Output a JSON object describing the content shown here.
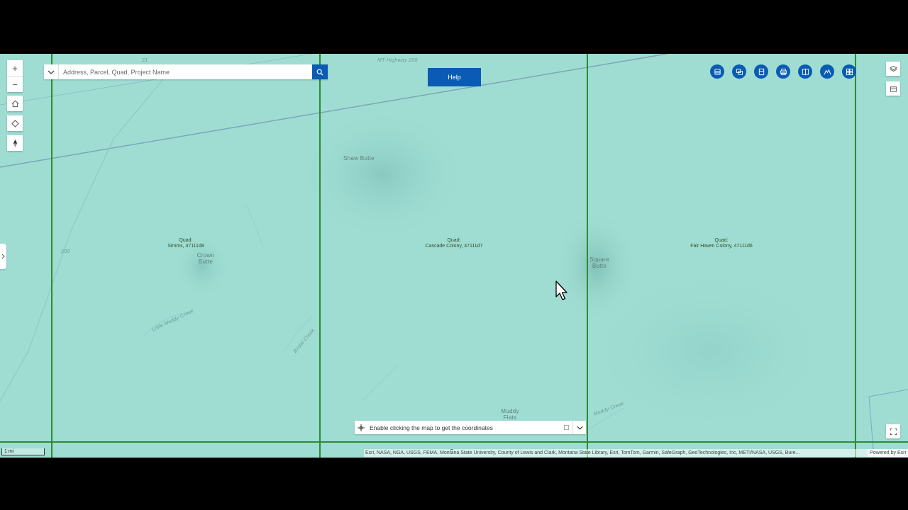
{
  "search": {
    "placeholder": "Address, Parcel, Quad, Project Name"
  },
  "help": {
    "label": "Help"
  },
  "coordinates": {
    "label": "Enable clicking the map to get the coordinates"
  },
  "attribution": {
    "text": "Esri, NASA, NGA, USGS, FEMA, Montana State University, County of Lewis and Clark, Montana State Library, Esri, TomTom, Garmin, SafeGraph, GeoTechnologies, Inc, METI/NASA, USGS, Bure...",
    "powered": "Powered by Esri"
  },
  "scale": {
    "label": "1 mi"
  },
  "quads": [
    {
      "line1": "Quad:",
      "line2": "Simms, 47111d8"
    },
    {
      "line1": "Quad:",
      "line2": "Cascade Colony, 47111d7"
    },
    {
      "line1": "Quad:",
      "line2": "Fair Haven Colony, 47111d6"
    }
  ],
  "features": {
    "shaw_butte": "Shaw Butte",
    "crown_butte": "Crown Butte",
    "square_butte": "Square Butte",
    "muddy_flats": "Muddy Flats",
    "mt_highway": "MT Highway 200",
    "route_21": "21",
    "route_200": "200",
    "little_muddy_creek": "Little Muddy Creek",
    "bridal_creek": "Bridal Creek",
    "muddy_creek": "Muddy Creek"
  },
  "widgets": [
    "layer-list",
    "basemap-gallery",
    "bookmarks",
    "print",
    "compare",
    "elevation-profile",
    "grid"
  ],
  "colors": {
    "map_bg": "#9fddd3",
    "accent": "#0a5bb3",
    "quad_line": "#2e8b2e"
  }
}
